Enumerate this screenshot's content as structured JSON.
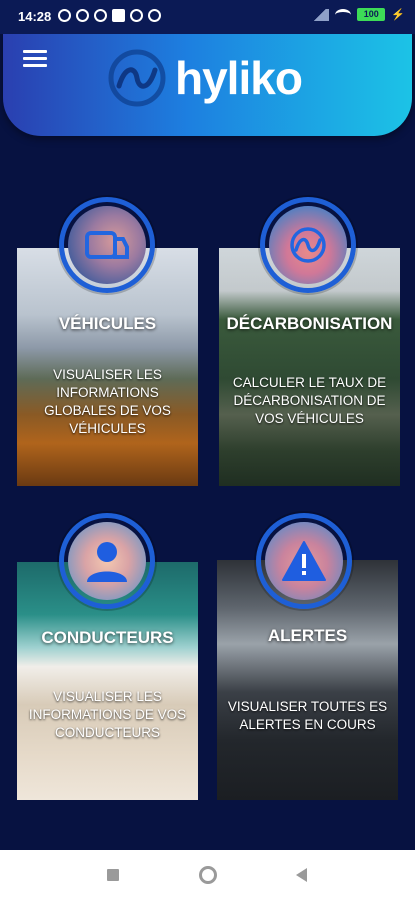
{
  "status_bar": {
    "time": "14:28",
    "battery": "100"
  },
  "app": {
    "name": "hyliko"
  },
  "cards": [
    {
      "title": "VÉHICULES",
      "description": "VISUALISER LES INFORMATIONS GLOBALES DE VOS VÉHICULES",
      "icon": "vehicle-icon"
    },
    {
      "title": "DÉCARBONISATION",
      "description": "CALCULER LE TAUX DE DÉCARBONISATION DE VOS VÉHICULES",
      "icon": "hyliko-logo-icon"
    },
    {
      "title": "CONDUCTEURS",
      "description": "VISUALISER LES INFORMATIONS DE VOS CONDUCTEURS",
      "icon": "person-icon"
    },
    {
      "title": "ALERTES",
      "description": "VISUALISER TOUTES ES ALERTES EN COURS",
      "icon": "warning-icon"
    }
  ],
  "colors": {
    "background": "#071241",
    "header_start": "#2a3fb0",
    "header_end": "#1cc3e6",
    "icon_blue": "#1e5fd6"
  }
}
